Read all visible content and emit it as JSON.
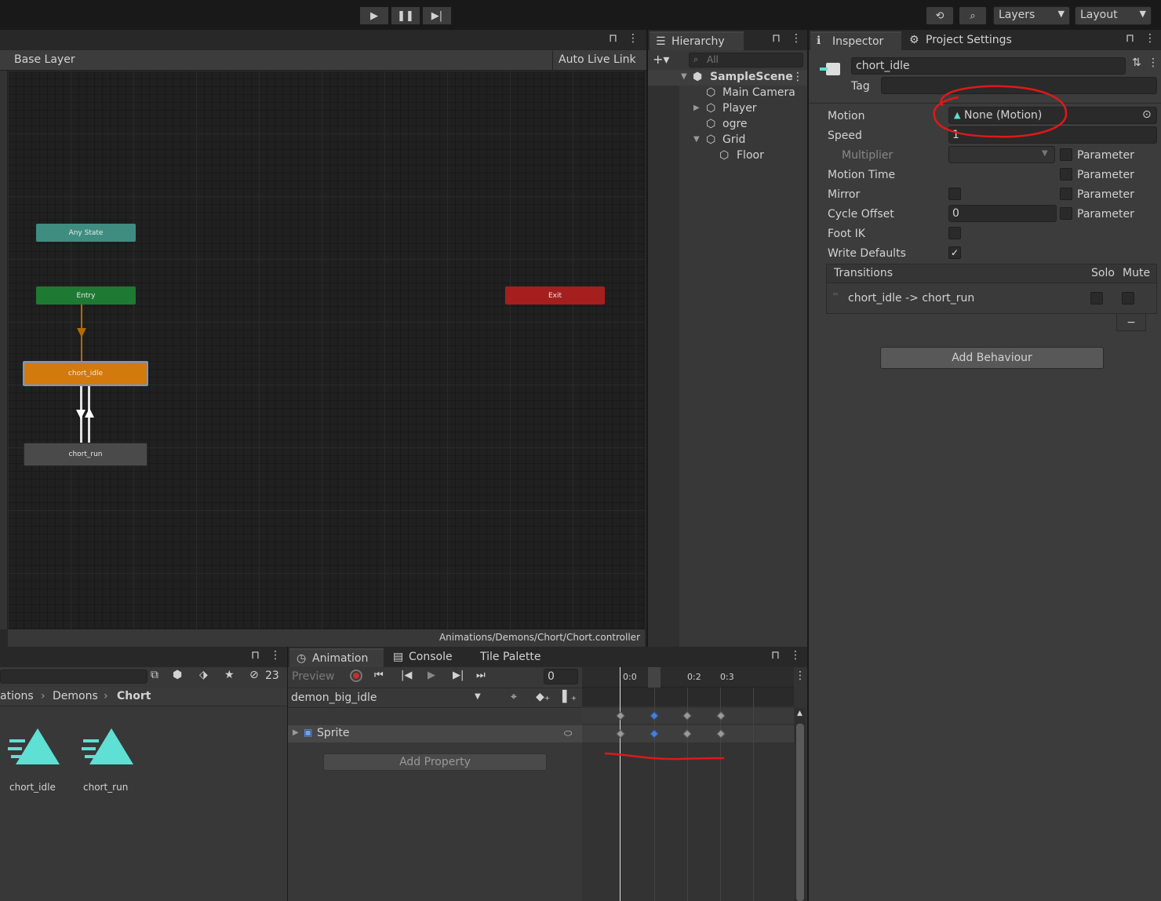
{
  "toolbar": {
    "layers_label": "Layers",
    "layout_label": "Layout"
  },
  "animator": {
    "layer_name": "Base Layer",
    "auto_live_link": "Auto Live Link",
    "path": "Animations/Demons/Chort/Chort.controller",
    "nodes": {
      "any_state": "Any State",
      "entry": "Entry",
      "exit": "Exit",
      "chort_idle": "chort_idle",
      "chort_run": "chort_run"
    }
  },
  "hierarchy": {
    "tab": "Hierarchy",
    "search_placeholder": "All",
    "scene": "SampleScene",
    "items": [
      "Main Camera",
      "Player",
      "ogre",
      "Grid",
      "Floor"
    ]
  },
  "inspector": {
    "tab": "Inspector",
    "project_tab": "Project Settings",
    "name": "chort_idle",
    "tag_label": "Tag",
    "motion_label": "Motion",
    "motion_value": "None (Motion)",
    "speed_label": "Speed",
    "speed_value": "1",
    "multiplier_label": "Multiplier",
    "parameter_label": "Parameter",
    "motion_time_label": "Motion Time",
    "mirror_label": "Mirror",
    "cycle_offset_label": "Cycle Offset",
    "cycle_offset_value": "0",
    "foot_ik_label": "Foot IK",
    "write_defaults_label": "Write Defaults",
    "transitions_label": "Transitions",
    "solo_label": "Solo",
    "mute_label": "Mute",
    "transition_row": "chort_idle -> chort_run",
    "remove_label": "−",
    "add_behaviour": "Add Behaviour"
  },
  "project": {
    "breadcrumb": [
      "ations",
      "Demons",
      "Chort"
    ],
    "hidden_count": "23",
    "assets": [
      "chort_idle",
      "chort_run"
    ]
  },
  "animation": {
    "tabs": [
      "Animation",
      "Console",
      "Tile Palette"
    ],
    "preview": "Preview",
    "frame": "0",
    "clip": "demon_big_idle",
    "property": "Sprite",
    "add_property": "Add Property",
    "ticks": [
      "0:0",
      "0:2",
      "0:3"
    ]
  },
  "colors": {
    "any_state": "#3f8d80",
    "entry": "#1e7a33",
    "exit": "#a51f1f",
    "selected_state": "#d37a0c",
    "state": "#4a4a4a",
    "annotation": "#e01818"
  }
}
